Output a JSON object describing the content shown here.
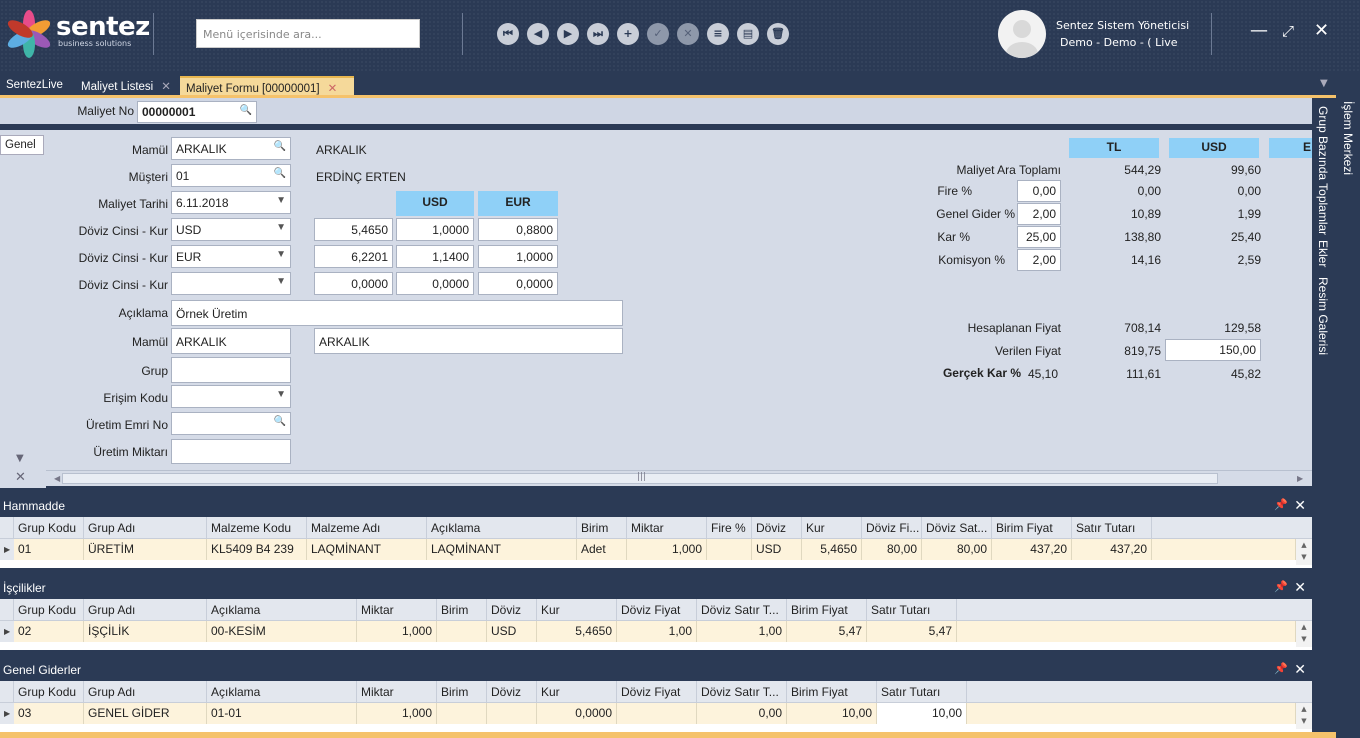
{
  "header": {
    "logo_name": "sentez",
    "logo_sub": "business solutions",
    "search_placeholder": "Menü içerisinde ara...",
    "user_name": "Sentez Sistem Yöneticisi",
    "user_context": "Demo - Demo - ( Live",
    "toolbar_icons": [
      "first-icon",
      "prev-icon",
      "next-icon",
      "last-icon",
      "add-icon",
      "confirm-icon",
      "cancel-icon",
      "list-icon",
      "print-icon",
      "delete-icon"
    ]
  },
  "tabs": [
    {
      "label": "SentezLive"
    },
    {
      "label": "Maliyet Listesi"
    },
    {
      "label": "Maliyet Formu [00000001]"
    }
  ],
  "maliyet_no": {
    "label": "Maliyet No",
    "value": "00000001"
  },
  "side_tab": "Genel",
  "form": {
    "mamul_label": "Mamül",
    "mamul_value": "ARKALIK",
    "mamul_desc": "ARKALIK",
    "musteri_label": "Müşteri",
    "musteri_value": "01",
    "musteri_desc": "ERDİNÇ ERTEN",
    "tarih_label": "Maliyet Tarihi",
    "tarih_value": "6.11.2018",
    "doviz_label": "Döviz Cinsi - Kur",
    "usd_header": "USD",
    "eur_header": "EUR",
    "doviz_rows": [
      {
        "cinsi": "USD",
        "kur": "5,4650",
        "usd": "1,0000",
        "eur": "0,8800"
      },
      {
        "cinsi": "EUR",
        "kur": "6,2201",
        "usd": "1,1400",
        "eur": "1,0000"
      },
      {
        "cinsi": "",
        "kur": "0,0000",
        "usd": "0,0000",
        "eur": "0,0000"
      }
    ],
    "aciklama_label": "Açıklama",
    "aciklama_value": "Örnek Üretim",
    "mamul2_label": "Mamül",
    "mamul2_value": "ARKALIK",
    "mamul2_desc": "ARKALIK",
    "grup_label": "Grup",
    "grup_value": "",
    "erisim_label": "Erişim Kodu",
    "erisim_value": "",
    "uretim_emri_label": "Üretim Emri No",
    "uretim_emri_value": "",
    "uretim_miktar_label": "Üretim Miktarı",
    "uretim_miktar_value": ""
  },
  "summary": {
    "headers": [
      "TL",
      "USD",
      "E"
    ],
    "ara_toplam": {
      "label": "Maliyet Ara Toplamı",
      "tl": "544,29",
      "usd": "99,60"
    },
    "fire": {
      "label": "Fire %",
      "input": "0,00",
      "tl": "0,00",
      "usd": "0,00"
    },
    "genel_gider": {
      "label": "Genel Gider %",
      "input": "2,00",
      "tl": "10,89",
      "usd": "1,99"
    },
    "kar": {
      "label": "Kar %",
      "input": "25,00",
      "tl": "138,80",
      "usd": "25,40"
    },
    "komisyon": {
      "label": "Komisyon %",
      "input": "2,00",
      "tl": "14,16",
      "usd": "2,59"
    },
    "hesaplanan": {
      "label": "Hesaplanan Fiyat",
      "tl": "708,14",
      "usd": "129,58"
    },
    "verilen": {
      "label": "Verilen Fiyat",
      "tl": "819,75",
      "usd": "150,00"
    },
    "gercek_kar": {
      "label": "Gerçek Kar %",
      "pct": "45,10",
      "tl": "111,61",
      "usd": "45,82"
    }
  },
  "right_panel": [
    "İşlem Merkezi",
    "Grup Bazında Toplamlar",
    "Ekler",
    "Resim Galerisi"
  ],
  "hammadde": {
    "title": "Hammadde",
    "columns": [
      "Grup Kodu",
      "Grup Adı",
      "Malzeme Kodu",
      "Malzeme Adı",
      "Açıklama",
      "Birim",
      "Miktar",
      "Fire %",
      "Döviz",
      "Kur",
      "Döviz Fi...",
      "Döviz Sat...",
      "Birim Fiyat",
      "Satır Tutarı"
    ],
    "row": [
      "01",
      "ÜRETİM",
      "KL5409 B4 239",
      "LAQMİNANT",
      "LAQMİNANT",
      "Adet",
      "1,000",
      "",
      "USD",
      "5,4650",
      "80,00",
      "80,00",
      "437,20",
      "437,20"
    ]
  },
  "iscilikler": {
    "title": "İşçilikler",
    "columns": [
      "Grup Kodu",
      "Grup Adı",
      "Açıklama",
      "Miktar",
      "Birim",
      "Döviz",
      "Kur",
      "Döviz Fiyat",
      "Döviz Satır T...",
      "Birim Fiyat",
      "Satır Tutarı"
    ],
    "row": [
      "02",
      "İŞÇİLİK",
      "00-KESİM",
      "1,000",
      "",
      "USD",
      "5,4650",
      "1,00",
      "1,00",
      "5,47",
      "5,47"
    ]
  },
  "genel_giderler": {
    "title": "Genel Giderler",
    "columns": [
      "Grup Kodu",
      "Grup Adı",
      "Açıklama",
      "Miktar",
      "Birim",
      "Döviz",
      "Kur",
      "Döviz Fiyat",
      "Döviz Satır T...",
      "Birim Fiyat",
      "Satır Tutarı"
    ],
    "row": [
      "03",
      "GENEL GİDER",
      "01-01",
      "1,000",
      "",
      "",
      "0,0000",
      "",
      "0,00",
      "10,00",
      "10,00"
    ]
  }
}
